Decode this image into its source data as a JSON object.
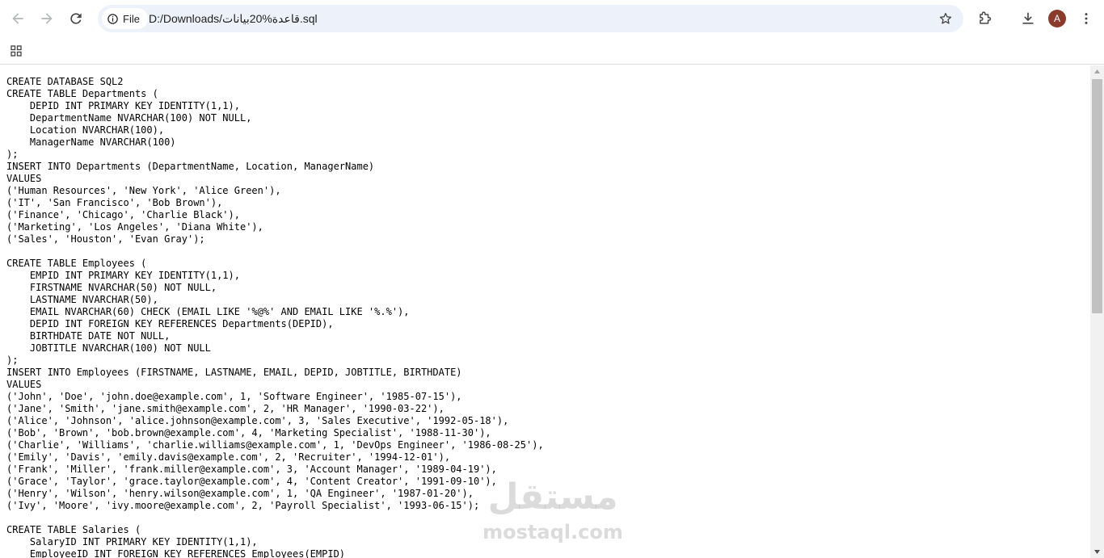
{
  "browser": {
    "site_chip_label": "File",
    "url": "D:/Downloads/قاعدة%20بيانات.sql",
    "profile_initial": "A"
  },
  "icons": {
    "back": "arrow-left-icon",
    "forward": "arrow-right-icon",
    "reload": "reload-icon",
    "site_info": "info-circle-icon",
    "bookmark": "star-icon",
    "extensions": "puzzle-icon",
    "downloads": "download-icon",
    "menu": "more-vertical-icon",
    "apps": "apps-grid-icon"
  },
  "file_content": "CREATE DATABASE SQL2\nCREATE TABLE Departments (\n    DEPID INT PRIMARY KEY IDENTITY(1,1),\n    DepartmentName NVARCHAR(100) NOT NULL,\n    Location NVARCHAR(100),\n    ManagerName NVARCHAR(100)\n);\nINSERT INTO Departments (DepartmentName, Location, ManagerName)\nVALUES\n('Human Resources', 'New York', 'Alice Green'),\n('IT', 'San Francisco', 'Bob Brown'),\n('Finance', 'Chicago', 'Charlie Black'),\n('Marketing', 'Los Angeles', 'Diana White'),\n('Sales', 'Houston', 'Evan Gray');\n\nCREATE TABLE Employees (\n    EMPID INT PRIMARY KEY IDENTITY(1,1),\n    FIRSTNAME NVARCHAR(50) NOT NULL,\n    LASTNAME NVARCHAR(50),\n    EMAIL NVARCHAR(60) CHECK (EMAIL LIKE '%@%' AND EMAIL LIKE '%.%'),\n    DEPID INT FOREIGN KEY REFERENCES Departments(DEPID),\n    BIRTHDATE DATE NOT NULL,\n    JOBTITLE NVARCHAR(100) NOT NULL\n);\nINSERT INTO Employees (FIRSTNAME, LASTNAME, EMAIL, DEPID, JOBTITLE, BIRTHDATE)\nVALUES\n('John', 'Doe', 'john.doe@example.com', 1, 'Software Engineer', '1985-07-15'),\n('Jane', 'Smith', 'jane.smith@example.com', 2, 'HR Manager', '1990-03-22'),\n('Alice', 'Johnson', 'alice.johnson@example.com', 3, 'Sales Executive', '1992-05-18'),\n('Bob', 'Brown', 'bob.brown@example.com', 4, 'Marketing Specialist', '1988-11-30'),\n('Charlie', 'Williams', 'charlie.williams@example.com', 1, 'DevOps Engineer', '1986-08-25'),\n('Emily', 'Davis', 'emily.davis@example.com', 2, 'Recruiter', '1994-12-01'),\n('Frank', 'Miller', 'frank.miller@example.com', 3, 'Account Manager', '1989-04-19'),\n('Grace', 'Taylor', 'grace.taylor@example.com', 4, 'Content Creator', '1991-09-10'),\n('Henry', 'Wilson', 'henry.wilson@example.com', 1, 'QA Engineer', '1987-01-20'),\n('Ivy', 'Moore', 'ivy.moore@example.com', 2, 'Payroll Specialist', '1993-06-15');\n\nCREATE TABLE Salaries (\n    SalaryID INT PRIMARY KEY IDENTITY(1,1),\n    EmployeeID INT FOREIGN KEY REFERENCES Employees(EMPID)",
  "watermark": {
    "arabic": "مستقل",
    "latin": "mostaql.com"
  }
}
